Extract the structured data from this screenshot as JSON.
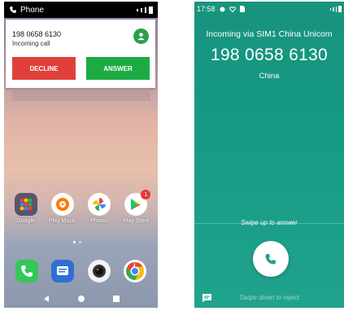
{
  "left_screen": {
    "status_bar": {
      "app_label": "Phone"
    },
    "call_notification": {
      "number": "198 0658 6130",
      "subtitle": "Incoming call",
      "decline_label": "DECLINE",
      "answer_label": "ANSWER"
    },
    "apps": [
      {
        "label": "Google",
        "icon": "folder-icon"
      },
      {
        "label": "Play Music",
        "icon": "play-music-icon"
      },
      {
        "label": "Photos",
        "icon": "photos-icon"
      },
      {
        "label": "Play Store",
        "icon": "play-store-icon",
        "badge": "1"
      }
    ],
    "dock": [
      {
        "icon": "phone-icon",
        "color": "#34c759"
      },
      {
        "icon": "messages-icon",
        "color": "#2f6fd6"
      },
      {
        "icon": "camera-icon",
        "color": "#f2f2f2"
      },
      {
        "icon": "chrome-icon",
        "color": "#ffffff"
      }
    ],
    "colors": {
      "decline": "#e0403a",
      "answer": "#1cab43"
    }
  },
  "right_screen": {
    "status_bar": {
      "time": "17:58"
    },
    "incoming_line": "Incoming via SIM1 China Unicom",
    "number": "198 0658 6130",
    "country": "China",
    "swipe_up_hint": "Swipe up to answer",
    "swipe_down_hint": "Swipe down to reject",
    "colors": {
      "background": "#18937d",
      "answer_button": "#ffffff"
    }
  }
}
